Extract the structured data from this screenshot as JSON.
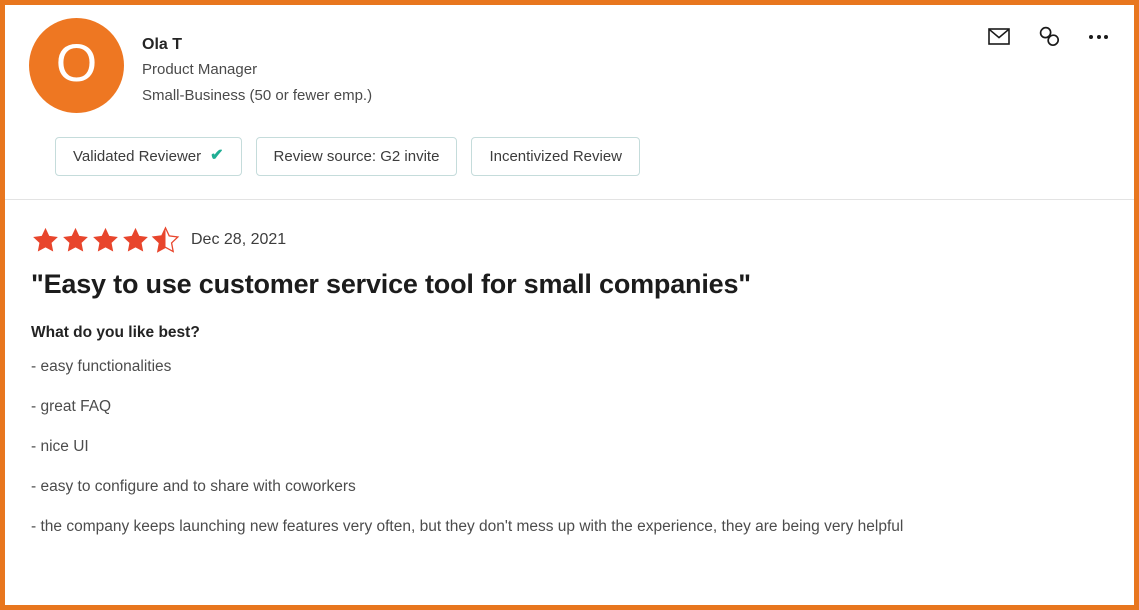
{
  "border_color": "#e8761e",
  "reviewer": {
    "avatar_initial": "O",
    "avatar_color": "#ee7722",
    "name": "Ola T",
    "role": "Product Manager",
    "company_size": "Small-Business (50 or fewer emp.)"
  },
  "header_actions": [
    {
      "name": "email-icon",
      "label": "Email"
    },
    {
      "name": "link-icon",
      "label": "Copy link"
    },
    {
      "name": "more-options-icon",
      "label": "More options"
    }
  ],
  "pills": [
    {
      "label": "Validated Reviewer",
      "has_check": true,
      "check_color": "#1fae94"
    },
    {
      "label": "Review source: G2 invite",
      "has_check": false
    },
    {
      "label": "Incentivized Review",
      "has_check": false
    }
  ],
  "review": {
    "rating": 4.5,
    "max_rating": 5,
    "star_color": "#e8452c",
    "date": "Dec 28, 2021",
    "title": "\"Easy to use customer service tool for small companies\"",
    "question": "What do you like best?",
    "answers": [
      "- easy functionalities",
      "- great FAQ",
      "- nice UI",
      "- easy to configure and to share with coworkers",
      "- the company keeps launching new features very often, but they don't mess up with the experience, they are being very helpful"
    ]
  }
}
